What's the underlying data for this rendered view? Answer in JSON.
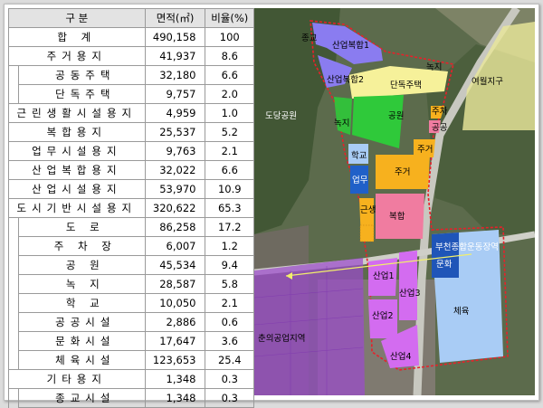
{
  "table": {
    "headers": [
      "구 분",
      "면적(㎡)",
      "비율(%)"
    ],
    "rows": [
      {
        "name": "합 계",
        "area": "490,158",
        "ratio": "100",
        "level": 0
      },
      {
        "name": "주거용지",
        "area": "41,937",
        "ratio": "8.6",
        "level": 0
      },
      {
        "name": "공동주택",
        "area": "32,180",
        "ratio": "6.6",
        "level": 1
      },
      {
        "name": "단독주택",
        "area": "9,757",
        "ratio": "2.0",
        "level": 1
      },
      {
        "name": "근린생활시설용지",
        "area": "4,959",
        "ratio": "1.0",
        "level": 0
      },
      {
        "name": "복합용지",
        "area": "25,537",
        "ratio": "5.2",
        "level": 0
      },
      {
        "name": "업무시설용지",
        "area": "9,763",
        "ratio": "2.1",
        "level": 0
      },
      {
        "name": "산업복합용지",
        "area": "32,022",
        "ratio": "6.6",
        "level": 0
      },
      {
        "name": "산업시설용지",
        "area": "53,970",
        "ratio": "10.9",
        "level": 0
      },
      {
        "name": "도시기반시설용지",
        "area": "320,622",
        "ratio": "65.3",
        "level": 0
      },
      {
        "name": "도 로",
        "area": "86,258",
        "ratio": "17.2",
        "level": 1
      },
      {
        "name": "주 차 장",
        "area": "6,007",
        "ratio": "1.2",
        "level": 1
      },
      {
        "name": "공 원",
        "area": "45,534",
        "ratio": "9.4",
        "level": 1
      },
      {
        "name": "녹 지",
        "area": "28,587",
        "ratio": "5.8",
        "level": 1
      },
      {
        "name": "학 교",
        "area": "10,050",
        "ratio": "2.1",
        "level": 1
      },
      {
        "name": "공공시설",
        "area": "2,886",
        "ratio": "0.6",
        "level": 1
      },
      {
        "name": "문화시설",
        "area": "17,647",
        "ratio": "3.6",
        "level": 1
      },
      {
        "name": "체육시설",
        "area": "123,653",
        "ratio": "25.4",
        "level": 1
      },
      {
        "name": "기타용지",
        "area": "1,348",
        "ratio": "0.3",
        "level": 0
      },
      {
        "name": "종교시설",
        "area": "1,348",
        "ratio": "0.3",
        "level": 1
      }
    ]
  },
  "map": {
    "labels": {
      "religion": "종교",
      "industrial_complex_1": "산업복합1",
      "industrial_complex_2": "산업복합2",
      "green_1": "녹지",
      "green_2": "녹지",
      "detached_housing": "단독주택",
      "yeowol_district": "여월지구",
      "dodang_park": "도당공원",
      "park": "공원",
      "parking": "주차",
      "public": "공공",
      "school": "학교",
      "residential_1": "주거",
      "residential_2": "주거",
      "office": "업무",
      "mixed_use": "복합",
      "neighborhood": "근생",
      "sports_complex_station": "부천종합운동장역",
      "culture": "문화",
      "sports": "체육",
      "industrial_1": "산업1",
      "industrial_2": "산업2",
      "industrial_3": "산업3",
      "industrial_4": "산업4",
      "chunui_industrial_area": "춘의공업지역"
    },
    "colors": {
      "industrial_complex": "#8a7cf0",
      "detached_housing": "#f6f19a",
      "park": "#2fc93a",
      "residential": "#f7b11e",
      "office": "#2060c8",
      "mixed_use": "#f07ca0",
      "sports": "#a9ccf5",
      "culture": "#1f55b8",
      "industrial": "#d36cf0",
      "chunui_area": "#9b4bcc",
      "yeowol_area": "#e9e79a",
      "boundary": "#e8202a"
    }
  }
}
